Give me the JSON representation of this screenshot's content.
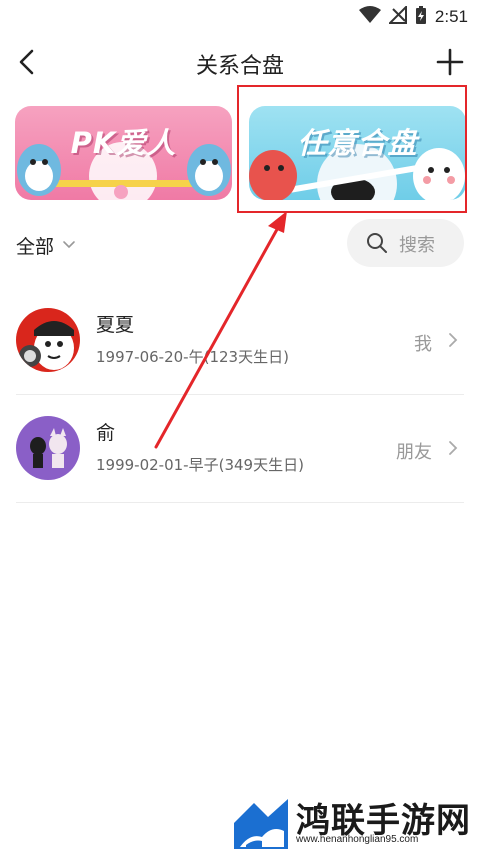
{
  "status_bar": {
    "time": "2:51"
  },
  "header": {
    "title": "关系合盘"
  },
  "banners": [
    {
      "label": "PK爱人",
      "color": "#f07aa5"
    },
    {
      "label": "任意合盘",
      "color": "#6fcde8"
    }
  ],
  "filter": {
    "label": "全部"
  },
  "search": {
    "placeholder": "搜索"
  },
  "contacts": [
    {
      "name": "夏夏",
      "info": "1997-06-20-午(123天生日)",
      "relation": "我"
    },
    {
      "name": "俞",
      "info": "1999-02-01-早子(349天生日)",
      "relation": "朋友"
    }
  ],
  "highlight": {
    "color": "#e4262a"
  },
  "watermark": {
    "title": "鸿联手游网",
    "url": "www.henanhonglian95.com"
  }
}
